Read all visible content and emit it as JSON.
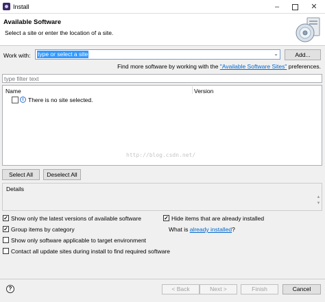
{
  "window": {
    "title": "Install",
    "controls": {
      "minimize": "–",
      "close": "✕"
    }
  },
  "header": {
    "title": "Available Software",
    "description": "Select a site or enter the location of a site."
  },
  "work_with": {
    "label": "Work with:",
    "value": "type or select a site",
    "add_label": "Add..."
  },
  "more_software": {
    "prefix": "Find more software by working with the ",
    "link": "\"Available Software Sites\"",
    "suffix": " preferences."
  },
  "filter": {
    "placeholder": "type filter text"
  },
  "tree": {
    "columns": [
      "Name",
      "Version"
    ],
    "rows": [
      {
        "text": "There is no site selected.",
        "checked": false,
        "icon": "info-icon"
      }
    ],
    "watermark": "http://blog.csdn.net/"
  },
  "selection_buttons": {
    "select_all": "Select All",
    "deselect_all": "Deselect All"
  },
  "details": {
    "label": "Details"
  },
  "options": {
    "show_latest": {
      "label": "Show only the latest versions of available software",
      "checked": true
    },
    "hide_installed": {
      "label": "Hide items that are already installed",
      "checked": true
    },
    "group_by_category": {
      "label": "Group items by category",
      "checked": true
    },
    "target_env": {
      "label": "Show only software applicable to target environment",
      "checked": false
    },
    "contact_sites": {
      "label": "Contact all update sites during install to find required software",
      "checked": false
    },
    "what_installed": {
      "prefix": "What is ",
      "link": "already installed",
      "suffix": "?"
    }
  },
  "footer": {
    "help_icon": "?",
    "back": "< Back",
    "next": "Next >",
    "finish": "Finish",
    "cancel": "Cancel"
  }
}
